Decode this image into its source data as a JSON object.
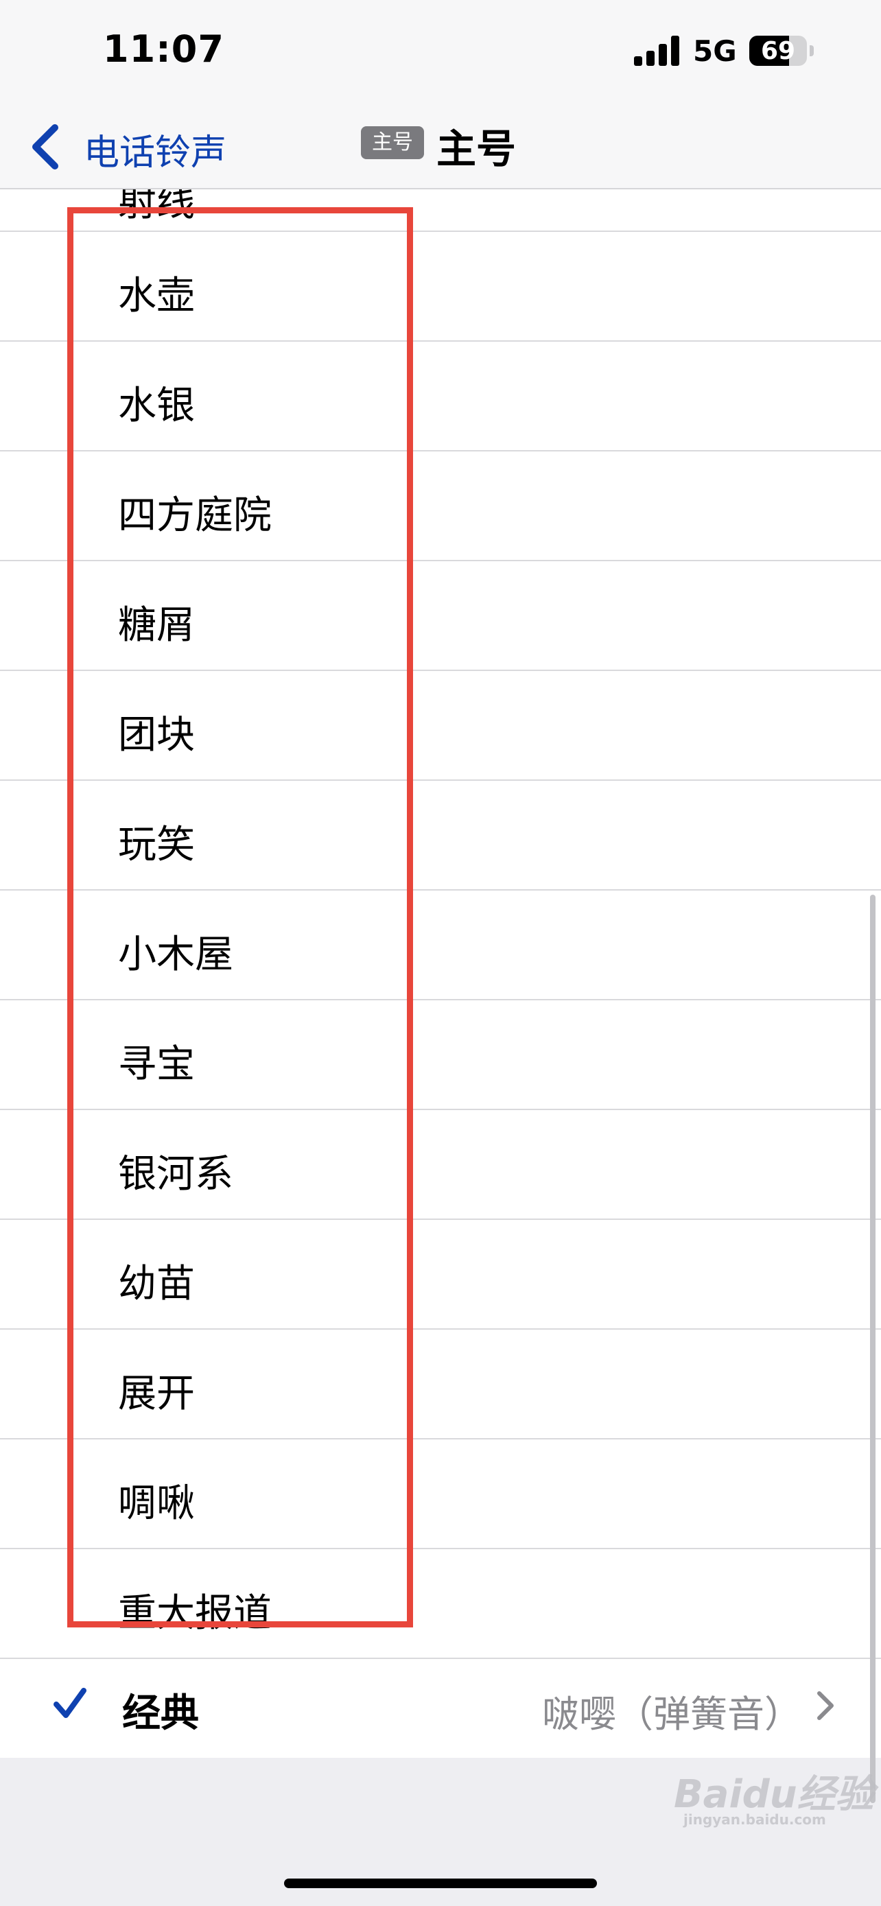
{
  "status_bar": {
    "time": "11:07",
    "network": "5G",
    "battery_percent": "69",
    "battery_level": 0.69
  },
  "nav": {
    "back_label": "电话铃声",
    "sim_badge": "主号",
    "title": "主号"
  },
  "ringtones": {
    "partial_item": "射线",
    "items": [
      "水壶",
      "水银",
      "四方庭院",
      "糖屑",
      "团块",
      "玩笑",
      "小木屋",
      "寻宝",
      "银河系",
      "幼苗",
      "展开",
      "啁啾",
      "重大报道"
    ]
  },
  "selected": {
    "label": "经典",
    "detail": "啵嘤（弹簧音）"
  },
  "watermark": {
    "logo": "Baidu经验",
    "url": "jingyan.baidu.com"
  },
  "colors": {
    "accent": "#0f41b0",
    "highlight_box": "#e8463b",
    "detail_gray": "#8a8a8e"
  }
}
